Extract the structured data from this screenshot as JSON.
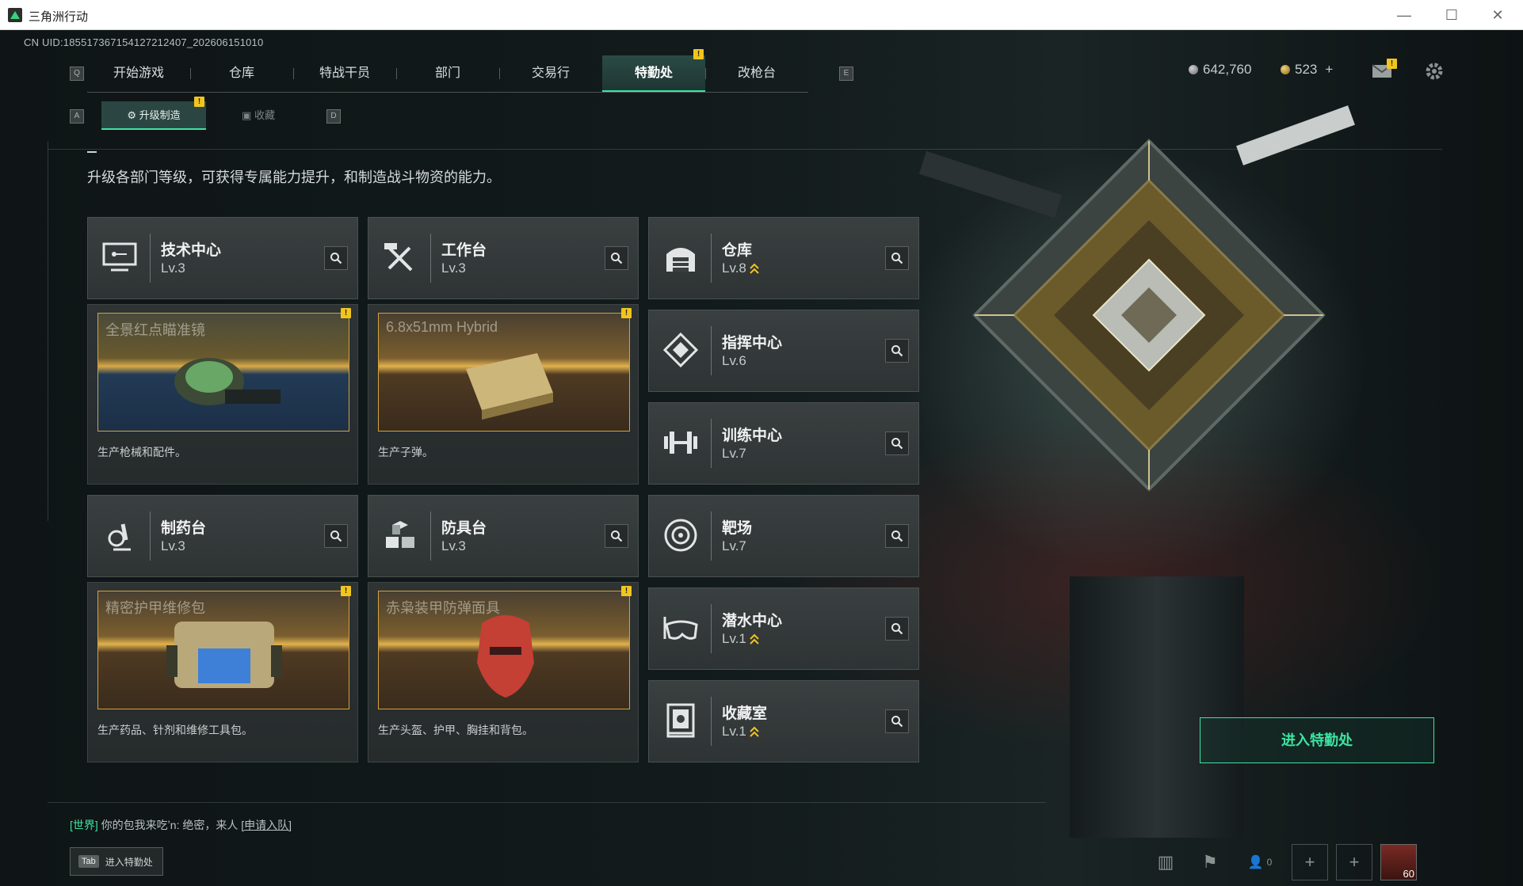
{
  "window": {
    "title": "三角洲行动",
    "minimize": "—",
    "maximize": "☐",
    "close": "✕"
  },
  "uid": "CN UID:185517367154127212407_202606151010",
  "nav": {
    "left_key": "Q",
    "right_key": "E",
    "items": [
      "开始游戏",
      "仓库",
      "特战干员",
      "部门",
      "交易行",
      "特勤处",
      "改枪台"
    ],
    "active": "特勤处",
    "badge": "!"
  },
  "sub_nav": {
    "left_key": "A",
    "right_key": "D",
    "items": [
      "升级制造",
      "收藏"
    ],
    "badge": "!"
  },
  "currency": {
    "silver": "642,760",
    "gold": "523",
    "gold_add": "+"
  },
  "mail_badge": "!",
  "description": "升级各部门等级，可获得专属能力提升，和制造战斗物资的能力。",
  "departments": [
    {
      "name": "技术中心",
      "level": "Lv.3",
      "icon": "computer-icon",
      "upgrade": false
    },
    {
      "name": "工作台",
      "level": "Lv.3",
      "icon": "tools-icon",
      "upgrade": false
    },
    {
      "name": "仓库",
      "level": "Lv.8",
      "icon": "warehouse-icon",
      "upgrade": true
    },
    {
      "name": "指挥中心",
      "level": "Lv.6",
      "icon": "command-icon",
      "upgrade": false
    },
    {
      "name": "训练中心",
      "level": "Lv.7",
      "icon": "dumbbell-icon",
      "upgrade": false
    },
    {
      "name": "制药台",
      "level": "Lv.3",
      "icon": "microscope-icon",
      "upgrade": false
    },
    {
      "name": "防具台",
      "level": "Lv.3",
      "icon": "cubes-icon",
      "upgrade": false
    },
    {
      "name": "靶场",
      "level": "Lv.7",
      "icon": "target-icon",
      "upgrade": false
    },
    {
      "name": "潜水中心",
      "level": "Lv.1",
      "icon": "goggles-icon",
      "upgrade": true
    },
    {
      "name": "收藏室",
      "level": "Lv.1",
      "icon": "vault-icon",
      "upgrade": true
    }
  ],
  "productions": [
    {
      "item": "全景红点瞄准镜",
      "desc": "生产枪械和配件。",
      "badge": "!"
    },
    {
      "item": "6.8x51mm Hybrid",
      "desc": "生产子弹。",
      "badge": "!"
    },
    {
      "item": "精密护甲维修包",
      "desc": "生产药品、针剂和维修工具包。",
      "badge": "!"
    },
    {
      "item": "赤枭装甲防弹面具",
      "desc": "生产头盔、护甲、胸挂和背包。",
      "badge": "!"
    }
  ],
  "enter_button": "进入特勤处",
  "chat": {
    "channel": "[世界]",
    "message": "你的包我来吃ʼn: 绝密，来人",
    "link": "[申请入队]"
  },
  "tab_hint": {
    "key": "Tab",
    "label": "进入特勤处"
  },
  "bottom_bar": {
    "friends_count": "0",
    "add": "+",
    "level": "60"
  },
  "colors": {
    "accent": "#3de3a2",
    "badge": "#f2c51d",
    "frame": "#d2a33a"
  }
}
